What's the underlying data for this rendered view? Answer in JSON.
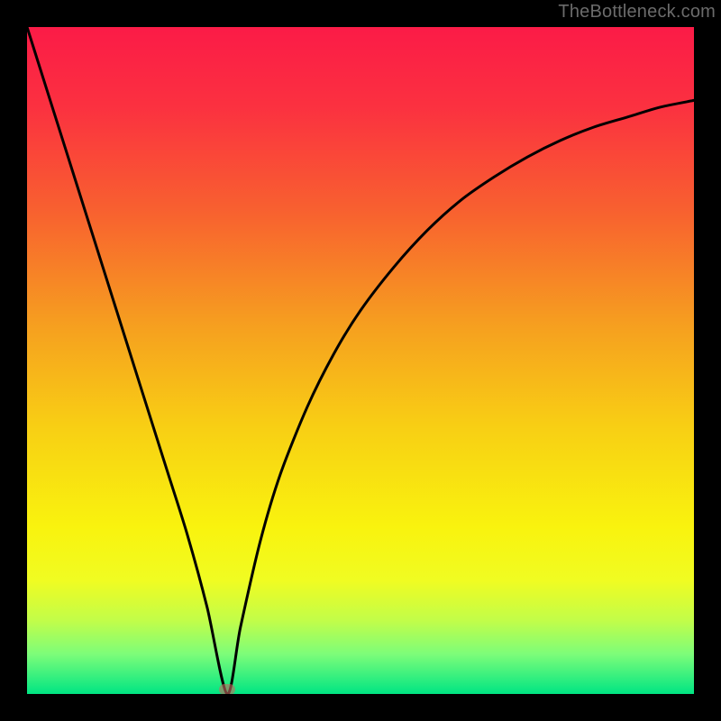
{
  "attribution": "TheBottleneck.com",
  "chart_data": {
    "type": "line",
    "title": "",
    "xlabel": "",
    "ylabel": "",
    "xlim": [
      0,
      1
    ],
    "ylim": [
      0,
      1
    ],
    "minimum_x": 0.3,
    "marker_color": "#c46a5f",
    "gradient_stops": [
      {
        "offset": 0.0,
        "color": "#fb1b47"
      },
      {
        "offset": 0.12,
        "color": "#fb3140"
      },
      {
        "offset": 0.28,
        "color": "#f8622f"
      },
      {
        "offset": 0.45,
        "color": "#f6a01f"
      },
      {
        "offset": 0.6,
        "color": "#f8cf14"
      },
      {
        "offset": 0.75,
        "color": "#f9f30e"
      },
      {
        "offset": 0.83,
        "color": "#f0fc22"
      },
      {
        "offset": 0.89,
        "color": "#c2fd49"
      },
      {
        "offset": 0.94,
        "color": "#7dfd79"
      },
      {
        "offset": 1.0,
        "color": "#00e583"
      }
    ],
    "series": [
      {
        "name": "bottleneck-curve",
        "points": [
          {
            "x": 0.0,
            "y": 1.0
          },
          {
            "x": 0.03,
            "y": 0.905
          },
          {
            "x": 0.06,
            "y": 0.81
          },
          {
            "x": 0.09,
            "y": 0.715
          },
          {
            "x": 0.12,
            "y": 0.62
          },
          {
            "x": 0.15,
            "y": 0.525
          },
          {
            "x": 0.18,
            "y": 0.43
          },
          {
            "x": 0.21,
            "y": 0.335
          },
          {
            "x": 0.24,
            "y": 0.24
          },
          {
            "x": 0.27,
            "y": 0.13
          },
          {
            "x": 0.3,
            "y": 0.0
          },
          {
            "x": 0.32,
            "y": 0.1
          },
          {
            "x": 0.35,
            "y": 0.23
          },
          {
            "x": 0.38,
            "y": 0.33
          },
          {
            "x": 0.42,
            "y": 0.43
          },
          {
            "x": 0.46,
            "y": 0.51
          },
          {
            "x": 0.5,
            "y": 0.575
          },
          {
            "x": 0.55,
            "y": 0.64
          },
          {
            "x": 0.6,
            "y": 0.695
          },
          {
            "x": 0.65,
            "y": 0.74
          },
          {
            "x": 0.7,
            "y": 0.775
          },
          {
            "x": 0.75,
            "y": 0.805
          },
          {
            "x": 0.8,
            "y": 0.83
          },
          {
            "x": 0.85,
            "y": 0.85
          },
          {
            "x": 0.9,
            "y": 0.865
          },
          {
            "x": 0.95,
            "y": 0.88
          },
          {
            "x": 1.0,
            "y": 0.89
          }
        ]
      }
    ]
  }
}
